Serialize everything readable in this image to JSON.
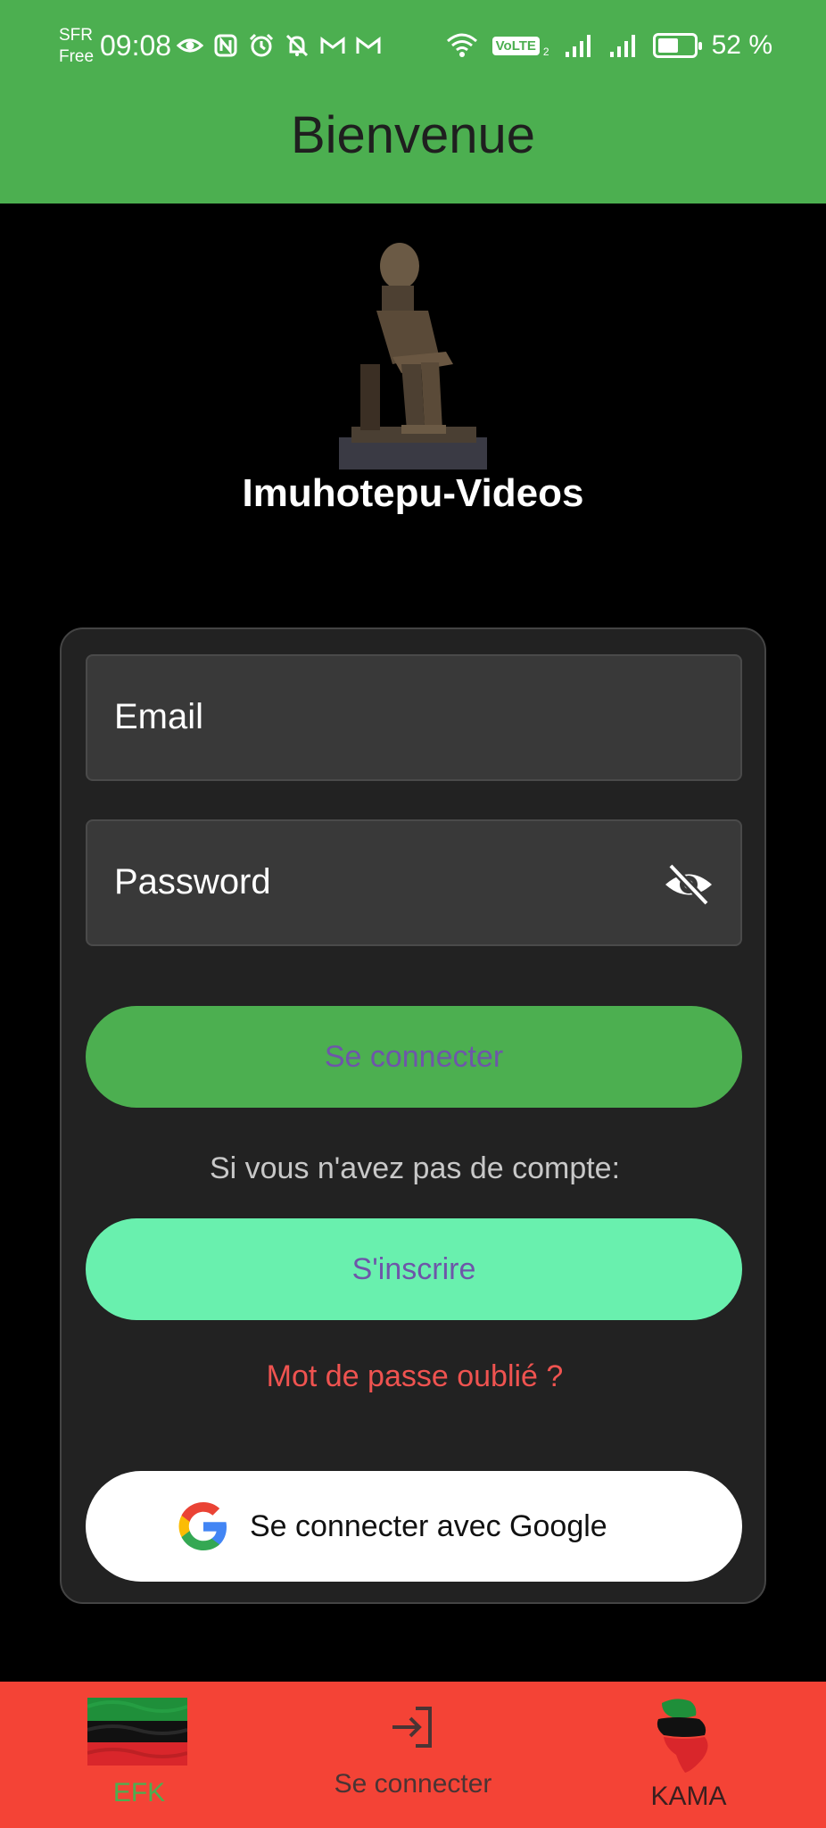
{
  "status_bar": {
    "carrier_line1": "SFR",
    "carrier_line2": "Free",
    "time": "09:08",
    "volte": "VoLTE",
    "volte_sub": "2",
    "battery": "52 %",
    "icons": [
      "eye-icon",
      "nfc-icon",
      "alarm-icon",
      "bell-off-icon",
      "gmail-icon",
      "gmail-icon"
    ]
  },
  "header": {
    "title": "Bienvenue"
  },
  "app": {
    "name": "Imuhotepu-Videos"
  },
  "form": {
    "email_label": "Email",
    "password_label": "Password",
    "login_button": "Se connecter",
    "no_account_hint": "Si vous n'avez pas de compte:",
    "signup_button": "S'inscrire",
    "forgot_link": "Mot de passe oublié ?",
    "google_button": "Se connecter avec Google"
  },
  "bottom_nav": {
    "items": [
      {
        "label": "EFK",
        "icon": "flag-icon"
      },
      {
        "label": "Se connecter",
        "icon": "login-icon"
      },
      {
        "label": "KAMA",
        "icon": "africa-map-icon"
      }
    ]
  },
  "colors": {
    "appbar": "#4caf50",
    "login_button": "#4caf50",
    "signup_button": "#69f0ae",
    "button_text": "#6e56a9",
    "forgot_link": "#ef5350",
    "bottom_nav": "#f44336"
  }
}
